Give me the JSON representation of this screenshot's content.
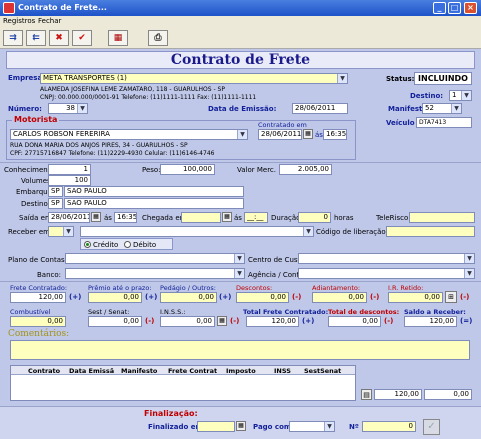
{
  "window": {
    "title": "Contrato de Frete..."
  },
  "menu": {
    "items": [
      "Registros",
      "Fechar"
    ]
  },
  "toolbar": {
    "icons": [
      "record-nav-icon",
      "record-nav-icon",
      "delete-icon",
      "confirm-icon",
      "calculator-icon",
      "print-icon"
    ]
  },
  "header": {
    "title": "Contrato de Frete"
  },
  "empresa": {
    "label": "Empresa:",
    "value": "META TRANSPORTES (1)",
    "address": "ALAMEDA JOSEFINA LEME ZAMATARO, 118 - GUARULHOS - SP",
    "details": "CNPJ: 00.000.000/0001-91 Telefone: (11)1111-1111 Fax: (11)1111-1111"
  },
  "status": {
    "label": "Status:",
    "value": "INCLUINDO"
  },
  "destino_top": {
    "label": "Destino:",
    "value": "1"
  },
  "numero": {
    "label": "Número:",
    "value": "38"
  },
  "emissao": {
    "label": "Data de Emissão:",
    "value": "28/06/2011"
  },
  "manifesto": {
    "label": "Manifesto",
    "value": "52"
  },
  "veiculo": {
    "label": "Veículo",
    "value": "DTA7413"
  },
  "motorista": {
    "legend": "Motorista",
    "name": "CARLOS ROBSON FERERIRA",
    "address": "RUA DONA MARIA DOS ANJOS PIRES, 34 - GUARULHOS - SP",
    "details": "CPF: 27715716847 Telefone: (11)2229-4930 Celular: (11)6146-4746",
    "contratado_label": "Contratado em",
    "contratado_date": "28/06/2011",
    "as": "ás",
    "contratado_time": "16:35"
  },
  "carga": {
    "conhecimentos_label": "Conhecimentos",
    "conhecimentos": "1",
    "volumes_label": "Volumes",
    "volumes": "100",
    "peso_label": "Peso:",
    "peso": "100,000",
    "valor_label": "Valor Merc.",
    "valor": "2.005,00"
  },
  "embarque": {
    "label": "Embarque",
    "uf": "SP",
    "cidade": "SÃO PAULO"
  },
  "destino": {
    "label": "Destino",
    "uf": "SP",
    "cidade": "SÃO PAULO"
  },
  "saida": {
    "label": "Saída em",
    "date": "28/06/2011",
    "as": "ás",
    "time": "16:35",
    "chegada_label": "Chegada em",
    "chegada_time": "__:__",
    "duracao_label": "Duração:",
    "duracao": "0",
    "horas": "horas",
    "telerisco_label": "TeleRisco"
  },
  "receber": {
    "label": "Receber em:",
    "liberacao_label": "Código de liberação"
  },
  "pagamento": {
    "credito": "Crédito",
    "debito": "Débito"
  },
  "plano": {
    "label": "Plano de Contas:",
    "centro_label": "Centro de Custo"
  },
  "banco": {
    "label": "Banco:",
    "agencia_label": "Agência / Conta"
  },
  "valores": {
    "frete_contratado_label": "Frete Contratado:",
    "frete_contratado": "120,00",
    "premio_label": "Prêmio até o prazo:",
    "premio": "0,00",
    "pedagio_label": "Pedágio / Outros:",
    "pedagio": "0,00",
    "descontos_label": "Descontos:",
    "descontos": "0,00",
    "adiantamento_label": "Adiantamento:",
    "adiantamento": "0,00",
    "ir_label": "I.R. Retido:",
    "ir": "0,00",
    "combustivel_label": "Combustível",
    "combustivel": "0,00",
    "sest_label": "Sest / Senat:",
    "sest": "0,00",
    "inss_label": "I.N.S.S.:",
    "inss": "0,00",
    "total_frete_label": "Total Frete Contratado:",
    "total_frete": "120,00",
    "total_desc_label": "Total de descontos:",
    "total_desc": "0,00",
    "saldo_label": "Saldo a Receber:",
    "saldo": "120,00"
  },
  "comentarios": {
    "label": "Comentários:"
  },
  "grid": {
    "columns": [
      "Contrato",
      "Data Emissã",
      "Manifesto",
      "Frete Contrat",
      "Imposto",
      "INSS",
      "SestSenat"
    ],
    "total1": "120,00",
    "total2": "0,00"
  },
  "finalizacao": {
    "label": "Finalização:",
    "finalizado_label": "Finalizado em:",
    "pago_label": "Pago com:",
    "numero_label": "Nº",
    "numero": "0"
  }
}
